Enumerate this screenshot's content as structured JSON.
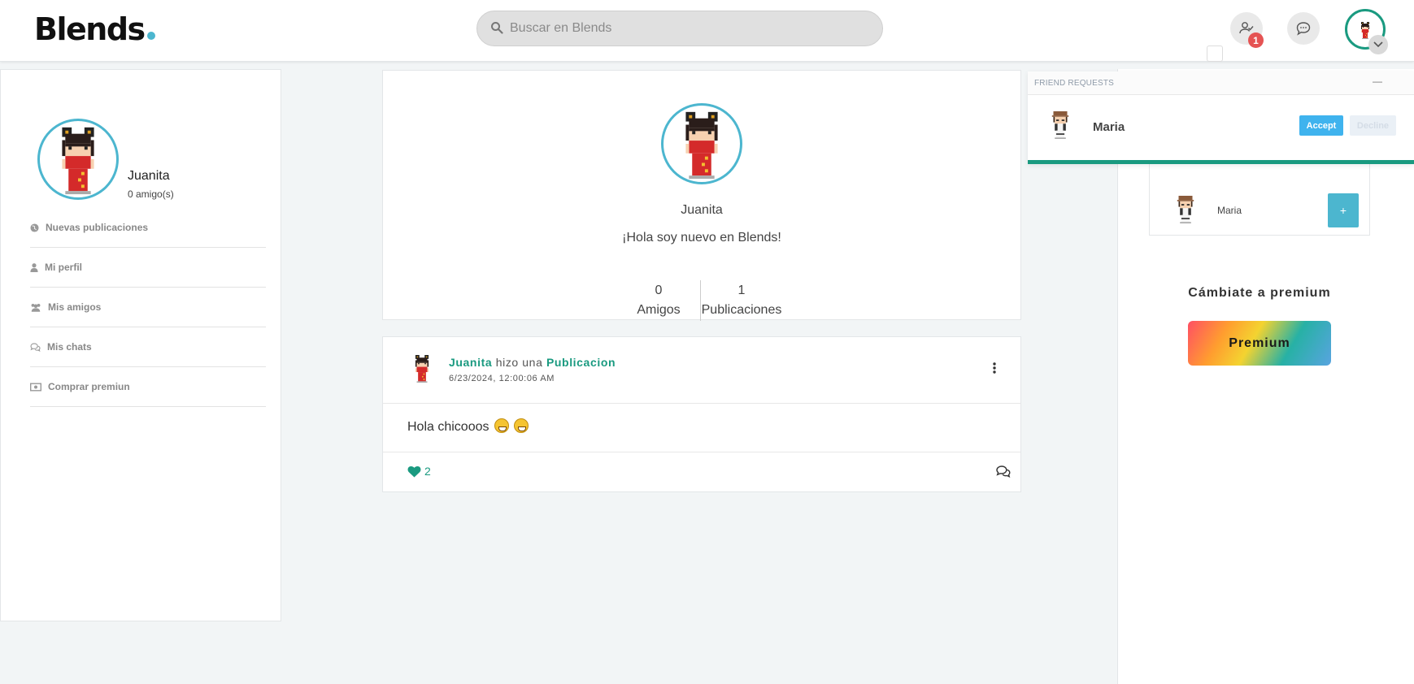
{
  "app": {
    "logo": "Blends"
  },
  "header": {
    "search_placeholder": "Buscar en Blends",
    "friend_requests_badge": "1"
  },
  "profile": {
    "name": "Juanita",
    "friends_count_label": "0 amigo(s)",
    "bio": "¡Hola soy nuevo en Blends!",
    "stats": [
      {
        "value": "0",
        "label": "Amigos"
      },
      {
        "value": "1",
        "label": "Publicaciones"
      }
    ]
  },
  "sidebar": {
    "items": [
      {
        "label": "Nuevas publicaciones",
        "icon": "globe-icon"
      },
      {
        "label": "Mi perfil",
        "icon": "user-icon"
      },
      {
        "label": "Mis amigos",
        "icon": "users-icon"
      },
      {
        "label": "Mis chats",
        "icon": "chat-icon"
      },
      {
        "label": "Comprar premiun",
        "icon": "money-icon"
      }
    ]
  },
  "post": {
    "author": "Juanita",
    "action": "hizo una",
    "type": "Publicacion",
    "date": "6/23/2024, 12:00:06 AM",
    "text": "Hola chicooos",
    "likes": "2"
  },
  "suggestions": {
    "name": "Maria",
    "add_label": "+"
  },
  "premium": {
    "title": "Cámbiate a premium",
    "button": "Premium"
  },
  "friend_requests": {
    "title": "FRIEND REQUESTS",
    "minimize": "—",
    "name": "Maria",
    "accept": "Accept",
    "decline": "Decline"
  },
  "colors": {
    "accent": "#1a9a80",
    "brand": "#4cb6cf",
    "badge": "#e55353"
  }
}
